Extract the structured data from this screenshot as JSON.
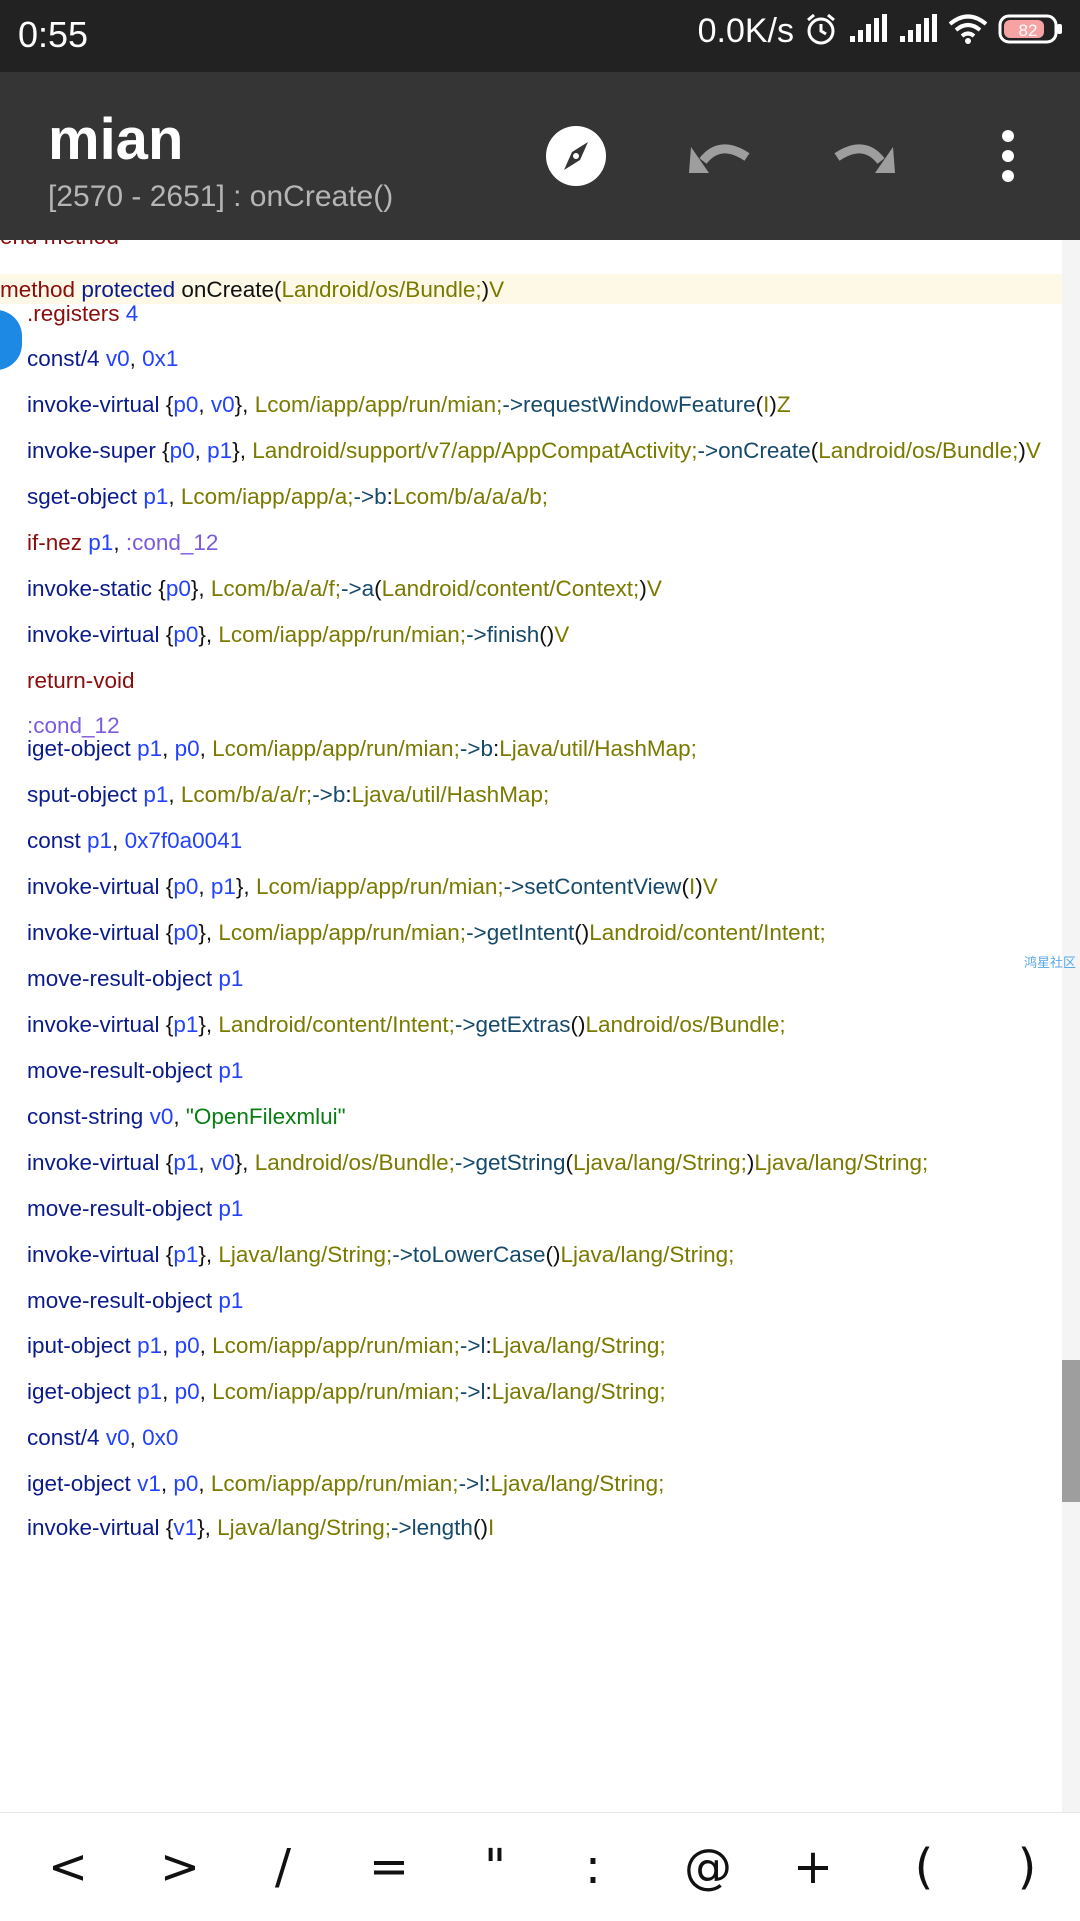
{
  "status_bar": {
    "time": "0:55",
    "net_speed": "0.0K/s",
    "battery": "82",
    "icons": [
      "alarm-icon",
      "signal-icon",
      "signal-icon",
      "wifi-icon",
      "battery-icon"
    ]
  },
  "app_bar": {
    "title": "mian",
    "subtitle": "[2570 - 2651] : onCreate()",
    "actions": [
      "compass-icon",
      "undo-icon",
      "redo-icon",
      "more-icon"
    ]
  },
  "editor": {
    "watermark": "鸿星社区",
    "lines": [
      {
        "top": true,
        "tokens": [
          [
            "c-red",
            "end method"
          ]
        ]
      },
      {
        "top": true,
        "hl": true,
        "tokens": [
          [
            "c-red",
            "method"
          ],
          [
            "c-punc",
            " "
          ],
          [
            "c-kw",
            "protected"
          ],
          [
            "c-punc",
            " "
          ],
          [
            "c-punc",
            "onCreate"
          ],
          [
            "c-punc",
            "("
          ],
          [
            "c-type",
            "Landroid/os/Bundle;"
          ],
          [
            "c-punc",
            ")"
          ],
          [
            "c-type",
            "V"
          ]
        ]
      },
      {
        "tokens": [
          [
            "c-dir",
            ".registers"
          ],
          [
            "c-punc",
            " "
          ],
          [
            "c-reg",
            "4"
          ]
        ]
      },
      {
        "tokens": [
          [
            "c-kw",
            "const/4"
          ],
          [
            "c-punc",
            " "
          ],
          [
            "c-reg",
            "v0"
          ],
          [
            "c-punc",
            ", "
          ],
          [
            "c-reg",
            "0x1"
          ]
        ]
      },
      {
        "tokens": [
          [
            "c-kw",
            "invoke-virtual"
          ],
          [
            "c-punc",
            " {"
          ],
          [
            "c-reg",
            "p0"
          ],
          [
            "c-punc",
            ", "
          ],
          [
            "c-reg",
            "v0"
          ],
          [
            "c-punc",
            "}, "
          ],
          [
            "c-type",
            "Lcom/iapp/app/run/mian;"
          ],
          [
            "c-arrow",
            "->"
          ],
          [
            "c-mth",
            "requestWindowFeature"
          ],
          [
            "c-punc",
            "("
          ],
          [
            "c-type",
            "I"
          ],
          [
            "c-punc",
            ")"
          ],
          [
            "c-type",
            "Z"
          ]
        ]
      },
      {
        "tokens": [
          [
            "c-kw",
            "invoke-super"
          ],
          [
            "c-punc",
            " {"
          ],
          [
            "c-reg",
            "p0"
          ],
          [
            "c-punc",
            ", "
          ],
          [
            "c-reg",
            "p1"
          ],
          [
            "c-punc",
            "}, "
          ],
          [
            "c-type",
            "Landroid/support/v7/app/AppCompatActivity;"
          ],
          [
            "c-arrow",
            "->"
          ],
          [
            "c-mth",
            "onCreate"
          ],
          [
            "c-punc",
            "("
          ],
          [
            "c-type",
            "Landroid/os/Bundle;"
          ],
          [
            "c-punc",
            ")"
          ],
          [
            "c-type",
            "V"
          ]
        ]
      },
      {
        "tokens": [
          [
            "c-kw",
            "sget-object"
          ],
          [
            "c-punc",
            " "
          ],
          [
            "c-reg",
            "p1"
          ],
          [
            "c-punc",
            ", "
          ],
          [
            "c-type",
            "Lcom/iapp/app/a;"
          ],
          [
            "c-arrow",
            "->"
          ],
          [
            "c-mth",
            "b"
          ],
          [
            "c-punc",
            ":"
          ],
          [
            "c-type",
            "Lcom/b/a/a/a/b;"
          ]
        ]
      },
      {
        "tokens": [
          [
            "c-red",
            "if-nez"
          ],
          [
            "c-punc",
            " "
          ],
          [
            "c-reg",
            "p1"
          ],
          [
            "c-punc",
            ", "
          ],
          [
            "c-lbl",
            ":cond_12"
          ]
        ]
      },
      {
        "tokens": [
          [
            "c-kw",
            "invoke-static"
          ],
          [
            "c-punc",
            " {"
          ],
          [
            "c-reg",
            "p0"
          ],
          [
            "c-punc",
            "}, "
          ],
          [
            "c-type",
            "Lcom/b/a/a/f;"
          ],
          [
            "c-arrow",
            "->"
          ],
          [
            "c-mth",
            "a"
          ],
          [
            "c-punc",
            "("
          ],
          [
            "c-type",
            "Landroid/content/Context;"
          ],
          [
            "c-punc",
            ")"
          ],
          [
            "c-type",
            "V"
          ]
        ]
      },
      {
        "tokens": [
          [
            "c-kw",
            "invoke-virtual"
          ],
          [
            "c-punc",
            " {"
          ],
          [
            "c-reg",
            "p0"
          ],
          [
            "c-punc",
            "}, "
          ],
          [
            "c-type",
            "Lcom/iapp/app/run/mian;"
          ],
          [
            "c-arrow",
            "->"
          ],
          [
            "c-mth",
            "finish"
          ],
          [
            "c-punc",
            "()"
          ],
          [
            "c-type",
            "V"
          ]
        ]
      },
      {
        "tokens": [
          [
            "c-red",
            "return-void"
          ]
        ]
      },
      {
        "tokens": [
          [
            "c-lbl",
            ":cond_12"
          ]
        ]
      },
      {
        "tokens": [
          [
            "c-kw",
            "iget-object"
          ],
          [
            "c-punc",
            " "
          ],
          [
            "c-reg",
            "p1"
          ],
          [
            "c-punc",
            ", "
          ],
          [
            "c-reg",
            "p0"
          ],
          [
            "c-punc",
            ", "
          ],
          [
            "c-type",
            "Lcom/iapp/app/run/mian;"
          ],
          [
            "c-arrow",
            "->"
          ],
          [
            "c-mth",
            "b"
          ],
          [
            "c-punc",
            ":"
          ],
          [
            "c-type",
            "Ljava/util/HashMap;"
          ]
        ]
      },
      {
        "tokens": [
          [
            "c-kw",
            "sput-object"
          ],
          [
            "c-punc",
            " "
          ],
          [
            "c-reg",
            "p1"
          ],
          [
            "c-punc",
            ", "
          ],
          [
            "c-type",
            "Lcom/b/a/a/r;"
          ],
          [
            "c-arrow",
            "->"
          ],
          [
            "c-mth",
            "b"
          ],
          [
            "c-punc",
            ":"
          ],
          [
            "c-type",
            "Ljava/util/HashMap;"
          ]
        ]
      },
      {
        "tokens": [
          [
            "c-kw",
            "const"
          ],
          [
            "c-punc",
            " "
          ],
          [
            "c-reg",
            "p1"
          ],
          [
            "c-punc",
            ", "
          ],
          [
            "c-reg",
            "0x7f0a0041"
          ]
        ]
      },
      {
        "tokens": [
          [
            "c-kw",
            "invoke-virtual"
          ],
          [
            "c-punc",
            " {"
          ],
          [
            "c-reg",
            "p0"
          ],
          [
            "c-punc",
            ", "
          ],
          [
            "c-reg",
            "p1"
          ],
          [
            "c-punc",
            "}, "
          ],
          [
            "c-type",
            "Lcom/iapp/app/run/mian;"
          ],
          [
            "c-arrow",
            "->"
          ],
          [
            "c-mth",
            "setContentView"
          ],
          [
            "c-punc",
            "("
          ],
          [
            "c-type",
            "I"
          ],
          [
            "c-punc",
            ")"
          ],
          [
            "c-type",
            "V"
          ]
        ]
      },
      {
        "tokens": [
          [
            "c-kw",
            "invoke-virtual"
          ],
          [
            "c-punc",
            " {"
          ],
          [
            "c-reg",
            "p0"
          ],
          [
            "c-punc",
            "}, "
          ],
          [
            "c-type",
            "Lcom/iapp/app/run/mian;"
          ],
          [
            "c-arrow",
            "->"
          ],
          [
            "c-mth",
            "getIntent"
          ],
          [
            "c-punc",
            "()"
          ],
          [
            "c-type",
            "Landroid/content/Intent;"
          ]
        ]
      },
      {
        "tokens": [
          [
            "c-kw",
            "move-result-object"
          ],
          [
            "c-punc",
            " "
          ],
          [
            "c-reg",
            "p1"
          ]
        ]
      },
      {
        "tokens": [
          [
            "c-kw",
            "invoke-virtual"
          ],
          [
            "c-punc",
            " {"
          ],
          [
            "c-reg",
            "p1"
          ],
          [
            "c-punc",
            "}, "
          ],
          [
            "c-type",
            "Landroid/content/Intent;"
          ],
          [
            "c-arrow",
            "->"
          ],
          [
            "c-mth",
            "getExtras"
          ],
          [
            "c-punc",
            "()"
          ],
          [
            "c-type",
            "Landroid/os/Bundle;"
          ]
        ]
      },
      {
        "tokens": [
          [
            "c-kw",
            "move-result-object"
          ],
          [
            "c-punc",
            " "
          ],
          [
            "c-reg",
            "p1"
          ]
        ]
      },
      {
        "tokens": [
          [
            "c-kw",
            "const-string"
          ],
          [
            "c-punc",
            " "
          ],
          [
            "c-reg",
            "v0"
          ],
          [
            "c-punc",
            ", "
          ],
          [
            "c-str",
            "\"OpenFilexmlui\""
          ]
        ]
      },
      {
        "tokens": [
          [
            "c-kw",
            "invoke-virtual"
          ],
          [
            "c-punc",
            " {"
          ],
          [
            "c-reg",
            "p1"
          ],
          [
            "c-punc",
            ", "
          ],
          [
            "c-reg",
            "v0"
          ],
          [
            "c-punc",
            "}, "
          ],
          [
            "c-type",
            "Landroid/os/Bundle;"
          ],
          [
            "c-arrow",
            "->"
          ],
          [
            "c-mth",
            "getString"
          ],
          [
            "c-punc",
            "("
          ],
          [
            "c-type",
            "Ljava/lang/String;"
          ],
          [
            "c-punc",
            ")"
          ],
          [
            "c-type",
            "Ljava/lang/String;"
          ]
        ]
      },
      {
        "tokens": [
          [
            "c-kw",
            "move-result-object"
          ],
          [
            "c-punc",
            " "
          ],
          [
            "c-reg",
            "p1"
          ]
        ]
      },
      {
        "tokens": [
          [
            "c-kw",
            "invoke-virtual"
          ],
          [
            "c-punc",
            " {"
          ],
          [
            "c-reg",
            "p1"
          ],
          [
            "c-punc",
            "}, "
          ],
          [
            "c-type",
            "Ljava/lang/String;"
          ],
          [
            "c-arrow",
            "->"
          ],
          [
            "c-mth",
            "toLowerCase"
          ],
          [
            "c-punc",
            "()"
          ],
          [
            "c-type",
            "Ljava/lang/String;"
          ]
        ]
      },
      {
        "tokens": [
          [
            "c-kw",
            "move-result-object"
          ],
          [
            "c-punc",
            " "
          ],
          [
            "c-reg",
            "p1"
          ]
        ]
      },
      {
        "tokens": [
          [
            "c-kw",
            "iput-object"
          ],
          [
            "c-punc",
            " "
          ],
          [
            "c-reg",
            "p1"
          ],
          [
            "c-punc",
            ", "
          ],
          [
            "c-reg",
            "p0"
          ],
          [
            "c-punc",
            ", "
          ],
          [
            "c-type",
            "Lcom/iapp/app/run/mian;"
          ],
          [
            "c-arrow",
            "->"
          ],
          [
            "c-mth",
            "l"
          ],
          [
            "c-punc",
            ":"
          ],
          [
            "c-type",
            "Ljava/lang/String;"
          ]
        ]
      },
      {
        "tokens": [
          [
            "c-kw",
            "iget-object"
          ],
          [
            "c-punc",
            " "
          ],
          [
            "c-reg",
            "p1"
          ],
          [
            "c-punc",
            ", "
          ],
          [
            "c-reg",
            "p0"
          ],
          [
            "c-punc",
            ", "
          ],
          [
            "c-type",
            "Lcom/iapp/app/run/mian;"
          ],
          [
            "c-arrow",
            "->"
          ],
          [
            "c-mth",
            "l"
          ],
          [
            "c-punc",
            ":"
          ],
          [
            "c-type",
            "Ljava/lang/String;"
          ]
        ]
      },
      {
        "tokens": [
          [
            "c-kw",
            "const/4"
          ],
          [
            "c-punc",
            " "
          ],
          [
            "c-reg",
            "v0"
          ],
          [
            "c-punc",
            ", "
          ],
          [
            "c-reg",
            "0x0"
          ]
        ]
      },
      {
        "tokens": [
          [
            "c-kw",
            "iget-object"
          ],
          [
            "c-punc",
            " "
          ],
          [
            "c-reg",
            "v1"
          ],
          [
            "c-punc",
            ", "
          ],
          [
            "c-reg",
            "p0"
          ],
          [
            "c-punc",
            ", "
          ],
          [
            "c-type",
            "Lcom/iapp/app/run/mian;"
          ],
          [
            "c-arrow",
            "->"
          ],
          [
            "c-mth",
            "l"
          ],
          [
            "c-punc",
            ":"
          ],
          [
            "c-type",
            "Ljava/lang/String;"
          ]
        ]
      },
      {
        "tokens": [
          [
            "c-kw",
            "invoke-virtual"
          ],
          [
            "c-punc",
            " {"
          ],
          [
            "c-reg",
            "v1"
          ],
          [
            "c-punc",
            "}, "
          ],
          [
            "c-type",
            "Ljava/lang/String;"
          ],
          [
            "c-arrow",
            "->"
          ],
          [
            "c-mth",
            "length"
          ],
          [
            "c-punc",
            "()"
          ],
          [
            "c-type",
            "I"
          ]
        ]
      }
    ]
  },
  "symbol_bar": {
    "keys": [
      "<",
      ">",
      "/",
      "=",
      "\"",
      ":",
      "@",
      "+",
      "(",
      ")"
    ]
  },
  "colors": {
    "status_bg": "#222222",
    "appbar_bg": "#353535",
    "keyword": "#0b1b8c",
    "register": "#2342ff",
    "type": "#7a7a00",
    "method_name": "#174a6a",
    "label": "#7a5adf",
    "string": "#0a7d14",
    "directive": "#8c0c0c",
    "handle": "#1e88e5"
  }
}
